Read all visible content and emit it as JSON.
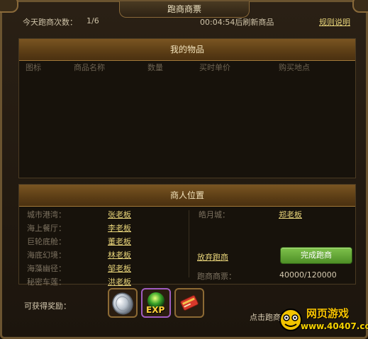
{
  "window": {
    "title": "跑商商票"
  },
  "info": {
    "count_label": "今天跑商次数：",
    "count_value": "1/6",
    "refresh_text": "00:04:54后刷新商品",
    "rules_link": "规则说明"
  },
  "my_items": {
    "header": "我的物品",
    "columns": [
      "图标",
      "商品名称",
      "数量",
      "买时单价",
      "购买地点"
    ]
  },
  "merchants": {
    "header": "商人位置",
    "left": [
      {
        "place": "城市港湾：",
        "name": "张老板"
      },
      {
        "place": "海上餐厅：",
        "name": "李老板"
      },
      {
        "place": "巨轮底舱：",
        "name": "董老板"
      },
      {
        "place": "海底幻境：",
        "name": "林老板"
      },
      {
        "place": "海藻幽径：",
        "name": "邹老板"
      },
      {
        "place": "秘密车莲：",
        "name": "洪老板"
      }
    ],
    "right": {
      "place": "皓月城：",
      "name": "郑老板"
    }
  },
  "actions": {
    "abandon": "放弃跑商",
    "complete": "完成跑商",
    "ticket_label": "跑商商票：",
    "ticket_value": "40000/120000"
  },
  "rewards": {
    "label": "可获得奖励：",
    "items": [
      "silver-coin-icon",
      "exp-orb-icon",
      "red-card-icon"
    ],
    "exp_text": "EXP"
  },
  "hint": "点击跑商",
  "watermark": {
    "top": "网页游戏",
    "bottom": "www.40407.com"
  },
  "colors": {
    "link": "#e8d47a",
    "accent_green": "#6aaf3a",
    "header_brown": "#6b4a1c"
  }
}
